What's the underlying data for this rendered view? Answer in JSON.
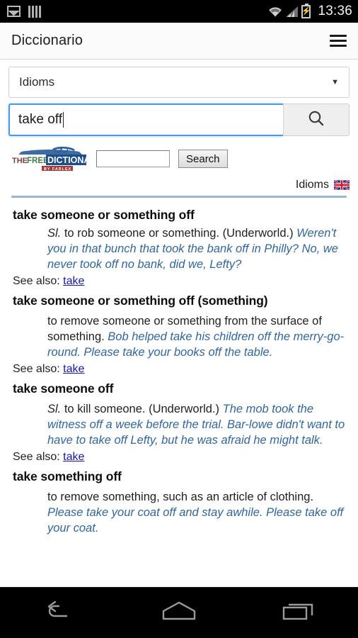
{
  "status_bar": {
    "clock": "13:36",
    "left_icons": [
      "image-icon",
      "barcode-icon"
    ],
    "right_icons": [
      "wifi-icon",
      "cellular-signal-icon",
      "battery-charging-icon"
    ]
  },
  "app_bar": {
    "title": "Diccionario",
    "menu_icon": "hamburger-menu-icon"
  },
  "controls": {
    "dictionary_select": {
      "value": "Idioms",
      "caret": "▼"
    },
    "search_input": {
      "value": "take off",
      "placeholder": ""
    },
    "search_button_icon": "magnifier-icon"
  },
  "widget": {
    "logo_text_the": "THE",
    "logo_text_free": "FREE",
    "logo_text_dictionary": "DICTIONARY",
    "logo_text_byfarlex": "BY FARLEX",
    "input_value": "",
    "input_placeholder": "",
    "search_button_label": "Search",
    "meta_label": "Idioms",
    "flag_icon": "uk-flag-icon"
  },
  "entries": [
    {
      "headword": "take someone or something off",
      "pos": "Sl.",
      "definition": " to rob someone or something. (Underworld.) ",
      "example": "Weren't you in that bunch that took the bank off in Philly? No, we never took off no bank, did we, Lefty?",
      "see_also_label": "See also:",
      "see_also_link": "take"
    },
    {
      "headword": "take someone or something off (something)",
      "pos": "",
      "definition": "to remove someone or something from the surface of something. ",
      "example": "Bob helped take his children off the merry-go-round. Please take your books off the table.",
      "see_also_label": "See also:",
      "see_also_link": "take"
    },
    {
      "headword": "take someone off",
      "pos": "Sl.",
      "definition": " to kill someone. (Underworld.) ",
      "example": "The mob took the witness off a week before the trial. Bar-lowe didn't want to have to take off Lefty, but he was afraid he might talk.",
      "see_also_label": "See also:",
      "see_also_link": "take"
    },
    {
      "headword": "take something off",
      "pos": "",
      "definition": "to remove something, such as an article of clothing. ",
      "example": "Please take your coat off and stay awhile. Please take off your coat.",
      "see_also_label": "",
      "see_also_link": ""
    }
  ],
  "nav_bar": {
    "back_icon": "back-arrow-icon",
    "home_icon": "home-icon",
    "recents_icon": "recent-apps-icon"
  },
  "colors": {
    "example_blue": "#33669a",
    "link_blue": "#1818a8",
    "focus_border": "#4a9ae8",
    "rule_blue": "#9bb6cf"
  }
}
